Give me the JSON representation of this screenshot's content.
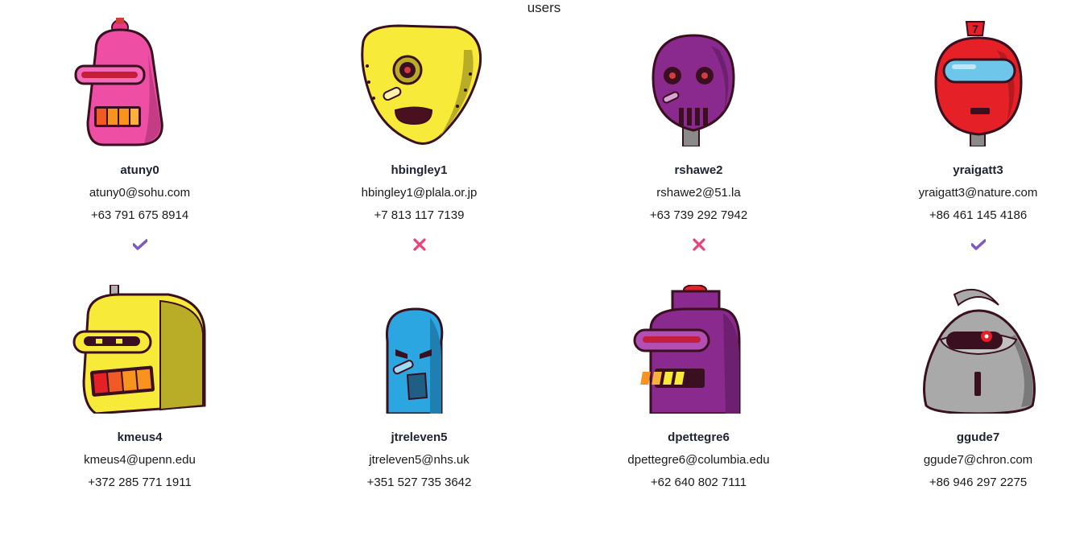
{
  "page": {
    "title": "users"
  },
  "users": [
    {
      "username": "atuny0",
      "email": "atuny0@sohu.com",
      "phone": "+63 791 675 8914",
      "status": "check",
      "robot": "pink",
      "color": "#ee4fa5"
    },
    {
      "username": "hbingley1",
      "email": "hbingley1@plala.or.jp",
      "phone": "+7 813 117 7139",
      "status": "cross",
      "robot": "yellow-eye",
      "color": "#f7ea38"
    },
    {
      "username": "rshawe2",
      "email": "rshawe2@51.la",
      "phone": "+63 739 292 7942",
      "status": "cross",
      "robot": "purple-skull",
      "color": "#8b2a8e"
    },
    {
      "username": "yraigatt3",
      "email": "yraigatt3@nature.com",
      "phone": "+86 461 145 4186",
      "status": "check",
      "robot": "red-visor",
      "color": "#e52026"
    },
    {
      "username": "kmeus4",
      "email": "kmeus4@upenn.edu",
      "phone": "+372 285 771 1911",
      "status": "",
      "robot": "yellow-box",
      "color": "#f7ea38"
    },
    {
      "username": "jtreleven5",
      "email": "jtreleven5@nhs.uk",
      "phone": "+351 527 735 3642",
      "status": "",
      "robot": "blue-tall",
      "color": "#2ba6e0"
    },
    {
      "username": "dpettegre6",
      "email": "dpettegre6@columbia.edu",
      "phone": "+62 640 802 7111",
      "status": "",
      "robot": "purple-visor",
      "color": "#8b2a8e"
    },
    {
      "username": "ggude7",
      "email": "ggude7@chron.com",
      "phone": "+86 946 297 2275",
      "status": "",
      "robot": "grey-cyclops",
      "color": "#a9a9a9"
    }
  ],
  "colors": {
    "check": "#7e57c2",
    "cross": "#ec407a"
  }
}
